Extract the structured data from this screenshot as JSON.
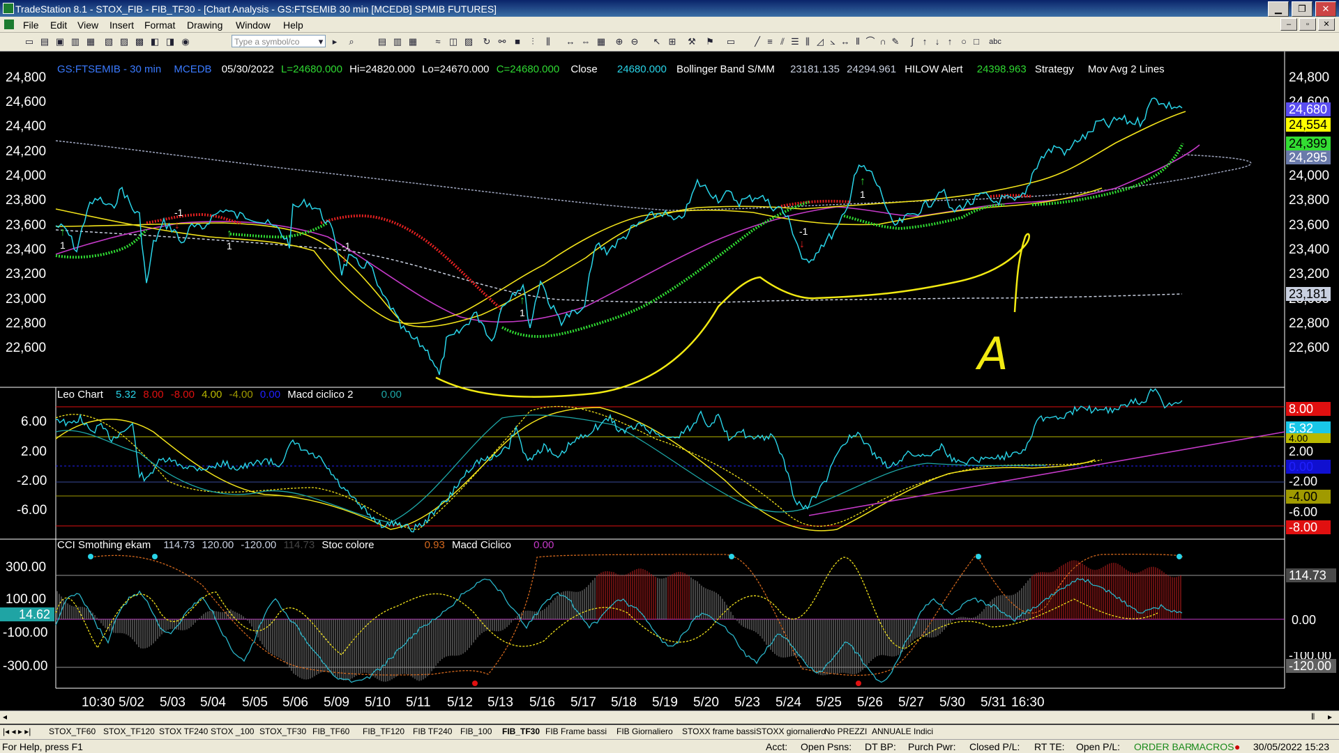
{
  "window": {
    "title": "TradeStation 8.1 - STOX_FIB - FIB_TF30 - [Chart Analysis - GS:FTSEMIB  30 min  [MCEDB] SPMIB FUTURES]",
    "buttons": [
      "▁",
      "❐",
      "✕"
    ]
  },
  "menu": [
    "File",
    "Edit",
    "View",
    "Insert",
    "Format",
    "Drawing",
    "Window",
    "Help"
  ],
  "toolbar": {
    "symbol_placeholder": "Type a symbol/co",
    "text_tool": "abc",
    "icon_names": [
      "new-icon",
      "open-icon",
      "save-icon",
      "print-icon",
      "chart-icon",
      "radar-icon",
      "matrix-icon",
      "zoom-in-icon",
      "zoom-out-icon",
      "pointer-icon",
      "trendline-icon",
      "fib-icon",
      "ellipse-icon",
      "rectangle-icon"
    ]
  },
  "colors": {
    "background": "#000000",
    "price": "#29d4e8",
    "bollinger": "#f1e21a",
    "hilow_up": "#2fd932",
    "hilow_down": "#e02020",
    "mov_avg": "#c53ac8",
    "gray_line": "#a0a7c0",
    "annotation": "#f2ea12"
  },
  "price_panel": {
    "header": {
      "symbol": "GS:FTSEMIB - 30 min",
      "source": "MCEDB",
      "date": "05/30/2022",
      "open": "L=24680.000",
      "high": "Hi=24820.000",
      "low": "Lo=24670.000",
      "close_c": "C=24680.000",
      "close_label": "Close",
      "close_val": "24680.000",
      "bb_label": "Bollinger Band S/MM",
      "bb1": "23181.135",
      "bb2": "24294.961",
      "hilow_label": "HILOW Alert",
      "hilow_val": "24398.963",
      "strategy": "Strategy",
      "movavg": "Mov Avg 2 Lines"
    },
    "y_axis": [
      "24,800",
      "24,600",
      "24,400",
      "24,200",
      "24,000",
      "23,800",
      "23,600",
      "23,400",
      "23,200",
      "23,000",
      "22,800",
      "22,600"
    ],
    "price_labels": [
      {
        "text": "24,680",
        "bg": "#5a4df0",
        "fg": "#ffffff"
      },
      {
        "text": "24,554",
        "bg": "#ffff00",
        "fg": "#000000"
      },
      {
        "text": "24,399",
        "bg": "#33dd33",
        "fg": "#000000"
      },
      {
        "text": "24,295",
        "bg": "#6a7aaa",
        "fg": "#ffffff"
      },
      {
        "text": "23,181",
        "bg": "#c9d0e0",
        "fg": "#000000"
      }
    ],
    "signal_labels": [
      "1",
      "-1",
      "1",
      "-1",
      "1",
      "-1",
      "1"
    ],
    "annotation_letter": "A"
  },
  "osc1_panel": {
    "header": {
      "name": "Leo Chart",
      "v1": "5.32",
      "v2": "8.00",
      "v3": "-8.00",
      "v4": "4.00",
      "v5": "-4.00",
      "v6": "0.00",
      "macd": "Macd ciclico 2",
      "v7": "0.00"
    },
    "y_axis": [
      "6.00",
      "2.00",
      "-2.00",
      "-6.00"
    ],
    "price_labels": [
      {
        "text": "8.00",
        "bg": "#e01010",
        "fg": "#ffffff"
      },
      {
        "text": "5.32",
        "bg": "#19c7e8",
        "fg": "#ffffff"
      },
      {
        "text": "4.00",
        "bg": "#b9b800",
        "fg": "#000000"
      },
      {
        "text": "2.00",
        "bg": "#000000",
        "fg": "#ffffff"
      },
      {
        "text": "0.00",
        "bg": "#1010d0",
        "fg": "#2020ff"
      },
      {
        "text": "-2.00",
        "bg": "#000000",
        "fg": "#ffffff"
      },
      {
        "text": "-4.00",
        "bg": "#a09a00",
        "fg": "#000000"
      },
      {
        "text": "-6.00",
        "bg": "#000000",
        "fg": "#ffffff"
      },
      {
        "text": "-8.00",
        "bg": "#e01010",
        "fg": "#ffffff"
      }
    ]
  },
  "osc2_panel": {
    "header": {
      "name": "CCI Smothing ekam",
      "v1": "114.73",
      "v2": "120.00",
      "v3": "-120.00",
      "v4": "114.73",
      "stoc": "Stoc colore",
      "v5": "0.93",
      "macd": "Macd Ciclico",
      "v6": "0.00"
    },
    "y_axis": [
      "300.00",
      "100.00",
      "-100.00",
      "-300.00"
    ],
    "left_value": "14.62",
    "price_labels": [
      {
        "text": "114.73",
        "bg": "#4a4a4a",
        "fg": "#ffffff"
      },
      {
        "text": "0.00",
        "bg": "#000000",
        "fg": "#ffffff"
      },
      {
        "text": "-100.00",
        "bg": "#000000",
        "fg": "#ffffff"
      },
      {
        "text": "-120.00",
        "bg": "#606060",
        "fg": "#ffffff"
      }
    ]
  },
  "x_axis": [
    "10:30",
    "5/02",
    "5/03",
    "5/04",
    "5/05",
    "5/06",
    "5/09",
    "5/10",
    "5/11",
    "5/12",
    "5/13",
    "5/16",
    "5/17",
    "5/18",
    "5/19",
    "5/20",
    "5/23",
    "5/24",
    "5/25",
    "5/26",
    "5/27",
    "5/30",
    "5/31",
    "16:30"
  ],
  "tabs": [
    "STOX_TF60",
    "STOX_TF120",
    "STOX TF240",
    "STOX _100",
    "STOX_TF30",
    "FIB_TF60",
    "FIB_TF120",
    "FIB TF240",
    "FIB_100",
    "FIB_TF30",
    "FIB Frame bassi",
    "FIB Giornaliero",
    "STOXX frame bassi",
    "STOXX giornaliero",
    "No PREZZI",
    "ANNUALE Indici"
  ],
  "active_tab": "FIB_TF30",
  "status": {
    "help": "For Help, press F1",
    "acct": "Acct:",
    "open_psns": "Open Psns:",
    "dt_bp": "DT BP:",
    "purch_pwr": "Purch Pwr:",
    "closed_pl": "Closed P/L:",
    "rt_te": "RT TE:",
    "open_pl": "Open P/L:",
    "order_bar": "ORDER BAR",
    "macros": "MACROS",
    "datetime": "30/05/2022 15:23"
  }
}
